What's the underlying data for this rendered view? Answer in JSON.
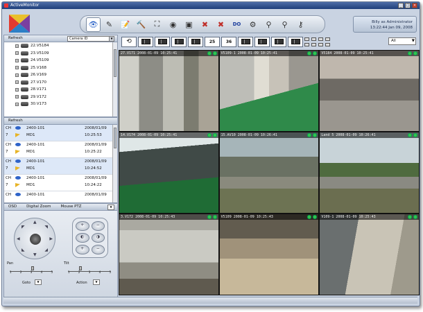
{
  "window": {
    "title": "ActiveMonitor"
  },
  "user": {
    "line1": "Billy as Administrator",
    "line2": "13:22:44 Jan 09, 2008"
  },
  "toolbar": {
    "tools": [
      {
        "icon": "eye-icon",
        "glyph": "👁",
        "active": true
      },
      {
        "icon": "event-log-icon",
        "glyph": "✎",
        "active": false
      },
      {
        "icon": "notepad-icon",
        "glyph": "📝",
        "active": false
      },
      {
        "icon": "tools-icon",
        "glyph": "🔨",
        "active": false
      },
      {
        "icon": "fullscreen-icon",
        "glyph": "⛶",
        "active": false
      },
      {
        "icon": "record-icon",
        "glyph": "◉",
        "active": false
      },
      {
        "icon": "camera-icon",
        "glyph": "▣",
        "active": false
      },
      {
        "icon": "disconnect-icon",
        "glyph": "✖",
        "active": false
      },
      {
        "icon": "disconnect-all-icon",
        "glyph": "✖",
        "active": false
      },
      {
        "icon": "do-icon",
        "glyph": "DO",
        "active": false
      },
      {
        "icon": "settings-icon",
        "glyph": "⚙",
        "active": false
      },
      {
        "icon": "user-icon",
        "glyph": "⚲",
        "active": false
      },
      {
        "icon": "users-icon",
        "glyph": "⚲",
        "active": false
      },
      {
        "icon": "keys-icon",
        "glyph": "⚷",
        "active": false
      }
    ]
  },
  "tree": {
    "refresh": "Refresh",
    "filter": "Camera ID",
    "items": [
      "22.V5184",
      "23.V5109",
      "24.V5109",
      "25.V168",
      "26.V169",
      "27.V170",
      "28.V171",
      "29.V172",
      "30.V173"
    ]
  },
  "events": {
    "refresh": "Refresh",
    "rows": [
      {
        "ch": "CH",
        "num": "7",
        "device": "2400-101",
        "md": "MD1",
        "date": "2008/01/09",
        "time": "10:25:53",
        "selected": true
      },
      {
        "ch": "CH",
        "num": "7",
        "device": "2400-101",
        "md": "MD1",
        "date": "2008/01/09",
        "time": "10:25:22",
        "selected": false
      },
      {
        "ch": "CH",
        "num": "7",
        "device": "2400-101",
        "md": "MD1",
        "date": "2008/01/09",
        "time": "10:24:52",
        "selected": true
      },
      {
        "ch": "CH",
        "num": "7",
        "device": "2400-101",
        "md": "MD1",
        "date": "2008/01/09",
        "time": "10:24:22",
        "selected": false
      },
      {
        "ch": "CH",
        "num": "",
        "device": "2400-101",
        "md": "",
        "date": "2008/01/09",
        "time": "",
        "selected": false
      }
    ]
  },
  "ptz": {
    "tabs": [
      "OSD",
      "Digital Zoom",
      "Mouse PTZ"
    ],
    "pan_label": "Pan",
    "tilt_label": "Tilt",
    "pan_value": 3,
    "tilt_value": 2,
    "goto_label": "Goto",
    "action_label": "Action",
    "ticks": [
      "1",
      "2",
      "3",
      "4",
      "5"
    ]
  },
  "view": {
    "layouts": [
      "1",
      "4",
      "9",
      "16",
      "25",
      "36"
    ],
    "stream_select": "All"
  },
  "cameras": [
    {
      "title": "27.V171  2008-01-09 10:25:41",
      "scene": "office"
    },
    {
      "title": "V5109-1  2008-01-09 10:25:41",
      "scene": "corridor"
    },
    {
      "title": "V5184  2008-01-09 10:25:41",
      "scene": "garage-exit"
    },
    {
      "title": "14.V174  2008-01-09 10:25:41",
      "scene": "parking"
    },
    {
      "title": "15.AV10  2008-01-09 10:26:41",
      "scene": "yard"
    },
    {
      "title": "Land 5  2008-01-09 10:26:41",
      "scene": "lawn"
    },
    {
      "title": "3.V172  2008-01-09 10:25:43",
      "scene": "loading-dock"
    },
    {
      "title": "V5109  2008-01-09 10:25:43",
      "scene": "warehouse"
    },
    {
      "title": "V109-1  2008-01-09 10:25:43",
      "scene": "storage"
    }
  ]
}
